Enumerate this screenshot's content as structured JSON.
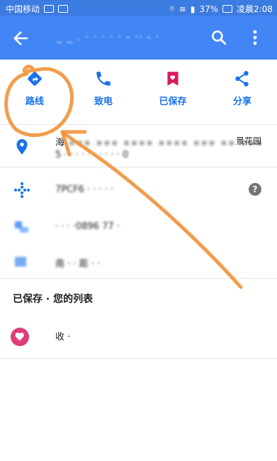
{
  "status_bar": {
    "carrier": "中国移动",
    "battery_percent": "37%",
    "time": "凌晨2:08"
  },
  "app_bar": {
    "title": "_ _ . · · · · · - ·· - ·"
  },
  "actions": [
    {
      "label": "路线",
      "icon": "directions-icon"
    },
    {
      "label": "致电",
      "icon": "phone-icon"
    },
    {
      "label": "已保存",
      "icon": "bookmark-heart-icon"
    },
    {
      "label": "分享",
      "icon": "share-icon"
    }
  ],
  "address": {
    "line1": "海",
    "line1_suffix": "景花园",
    "line2": "5 · · · · · · · · · · 0"
  },
  "plus_code": {
    "value": "7PCF6 · · · · ·"
  },
  "phone": {
    "value": "· · · ·0896 77 ·"
  },
  "area": {
    "value": "南 · · 距 · ·"
  },
  "saved_section": {
    "header": "已保存 · 您的列表",
    "item": "收 ·"
  },
  "colors": {
    "primary": "#4285f4",
    "status_bar": "#3c7be0",
    "action_blue": "#1a73e8",
    "saved_pink": "#d81b60",
    "annotation_orange": "#f0923a"
  }
}
